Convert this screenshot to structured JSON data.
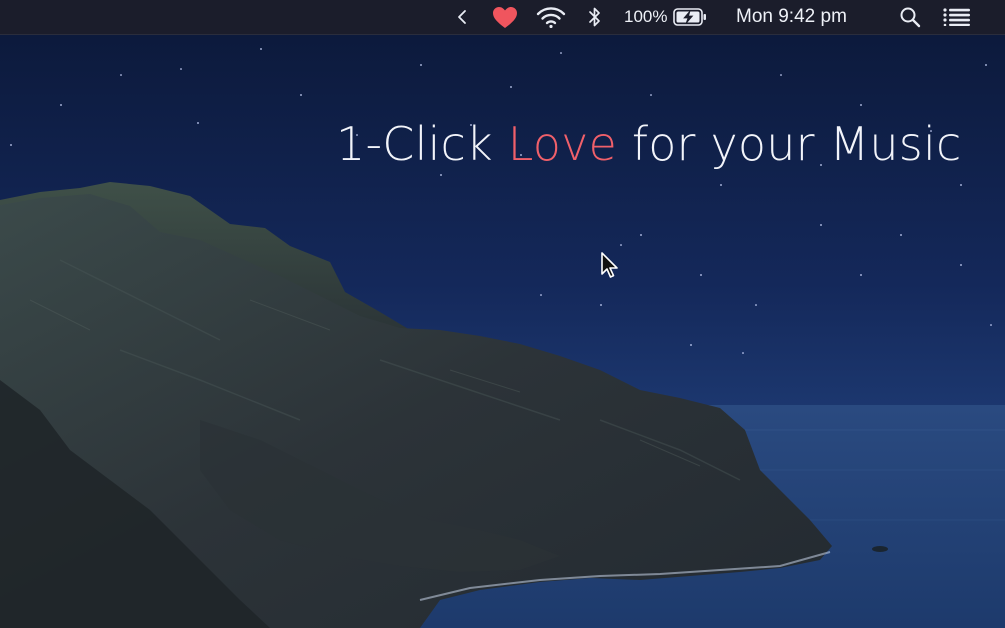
{
  "menubar": {
    "icons": {
      "chevron": "chevron-left-icon",
      "heart": "heart-icon",
      "wifi": "wifi-icon",
      "bluetooth": "bluetooth-icon",
      "battery": "battery-charging-icon",
      "search": "search-icon",
      "notification_center": "notification-center-icon"
    },
    "battery_percent": "100%",
    "clock": "Mon 9:42 pm",
    "heart_color": "#f0555e"
  },
  "headline": {
    "before": "1-Click ",
    "highlight": "Love",
    "after": " for your Music",
    "highlight_color": "#f0606a"
  },
  "colors": {
    "menubar_bg": "#1b1d2b",
    "sky_top": "#0b1838",
    "sea": "#2a4f86"
  }
}
